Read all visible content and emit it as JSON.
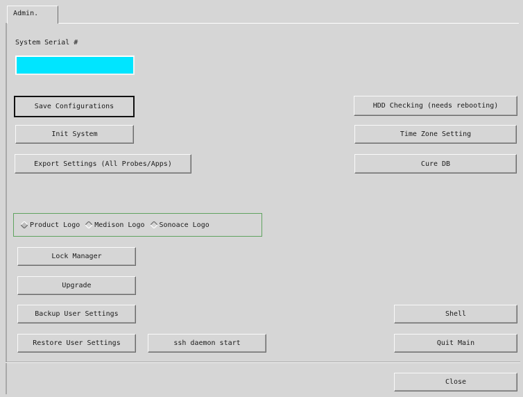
{
  "tabs": [
    {
      "label": "Admin."
    }
  ],
  "serial": {
    "label": "System Serial #",
    "value": ""
  },
  "left_buttons": {
    "save": "Save Configurations",
    "init": "Init System",
    "export": "Export Settings (All Probes/Apps)"
  },
  "right_buttons": {
    "hdd": "HDD Checking (needs rebooting)",
    "timezone": "Time Zone Setting",
    "cure": "Cure DB"
  },
  "logo_options": [
    {
      "label": "Product Logo",
      "selected": true
    },
    {
      "label": "Medison Logo",
      "selected": false
    },
    {
      "label": "Sonoace Logo",
      "selected": false
    }
  ],
  "lower_buttons": {
    "lock": "Lock Manager",
    "upgrade": "Upgrade",
    "backup": "Backup User Settings",
    "restore": "Restore User Settings",
    "ssh": "ssh daemon start",
    "shell": "Shell",
    "quit": "Quit Main"
  },
  "footer": {
    "close": "Close"
  },
  "colors": {
    "background": "#d6d6d6",
    "serial_field": "#00e5ff",
    "group_border": "#5fa35f"
  },
  "icons": {
    "radio_selected": "diamond-raised-icon",
    "radio_unselected": "diamond-sunken-icon"
  }
}
